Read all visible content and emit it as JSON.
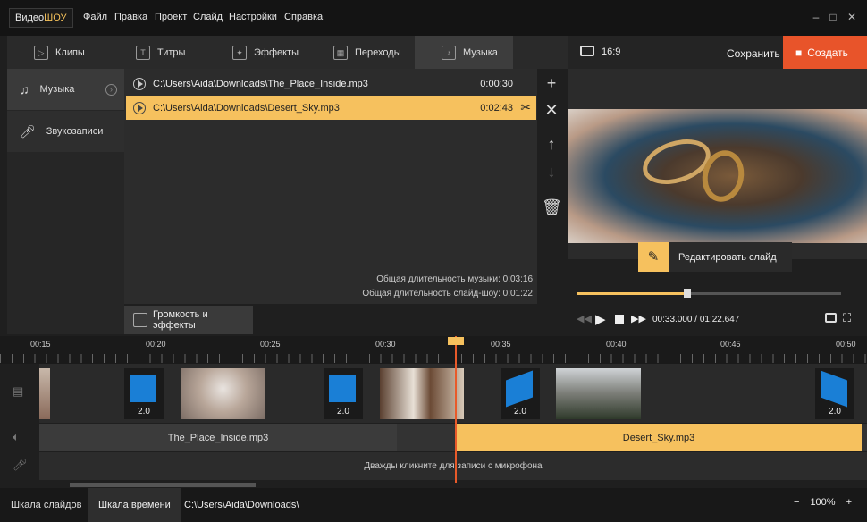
{
  "app": {
    "logo_a": "Видео",
    "logo_b": "ШОУ",
    "menu": [
      "Файл",
      "Правка",
      "Проект",
      "Слайд",
      "Настройки",
      "Справка"
    ]
  },
  "tabs": [
    "Клипы",
    "Титры",
    "Эффекты",
    "Переходы",
    "Музыка"
  ],
  "sidebar": [
    "Музыка",
    "Звукозаписи"
  ],
  "music": [
    {
      "path": "C:\\Users\\Aida\\Downloads\\The_Place_Inside.mp3",
      "duration": "0:00:30"
    },
    {
      "path": "C:\\Users\\Aida\\Downloads\\Desert_Sky.mp3",
      "duration": "0:02:43"
    }
  ],
  "stats": {
    "music": "Общая длительность музыки: 0:03:16",
    "show": "Общая длительность слайд-шоу: 0:01:22"
  },
  "volume_button": "Громкость и эффекты",
  "preview": {
    "aspect": "16:9",
    "save": "Сохранить",
    "create": "Создать",
    "edit": "Редактировать слайд",
    "time": "00:33.000 / 01:22.647",
    "progress": 0.42
  },
  "timeline": {
    "ticks": [
      "00:15",
      "00:20",
      "00:25",
      "00:30",
      "00:35",
      "00:40",
      "00:45",
      "00:50"
    ],
    "transition_label": "2.0",
    "audio": [
      "The_Place_Inside.mp3",
      "Desert_Sky.mp3"
    ],
    "mic_hint": "Дважды кликните для записи с микрофона"
  },
  "status": {
    "slides": "Шкала слайдов",
    "timeline": "Шкала времени",
    "path": "C:\\Users\\Aida\\Downloads\\",
    "zoom": "100%"
  },
  "colors": {
    "accent": "#f6c15e",
    "create": "#e8542a"
  }
}
